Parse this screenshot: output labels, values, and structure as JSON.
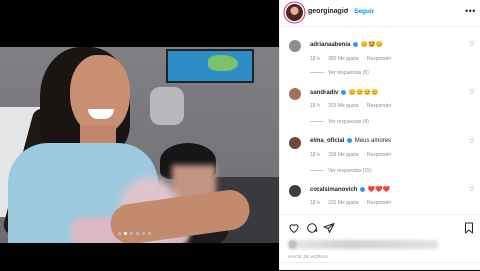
{
  "post": {
    "username": "georginagio",
    "separator": "•",
    "follow_label": "Seguir",
    "more_label": "•••",
    "time_label": "HACE 18 HORAS",
    "carousel_count": 6,
    "carousel_active": 2
  },
  "comments": [
    {
      "user": "adrianaabenia",
      "text": "😊🤩😊",
      "time": "18 h",
      "likes": "390 Me gusta",
      "reply": "Responder",
      "replies": "Ver respuestas (5)",
      "verified": true,
      "avatar_color": "#8a8f96"
    },
    {
      "user": "sandradiv",
      "text": "😊😊😊😊",
      "time": "18 h",
      "likes": "202 Me gusta",
      "reply": "Responder",
      "replies": "Ver respuestas (4)",
      "verified": true,
      "avatar_color": "#a0725a"
    },
    {
      "user": "elma_oficial",
      "text": "Meus amores",
      "time": "18 h",
      "likes": "339 Me gusta",
      "reply": "Responder",
      "replies": "Ver respuestas (15)",
      "verified": true,
      "avatar_color": "#6b4a3a"
    },
    {
      "user": "coralsimanovich",
      "text": "❤️❤️❤️",
      "time": "18 h",
      "likes": "231 Me gusta",
      "reply": "Responder",
      "replies": "",
      "verified": true,
      "avatar_color": "#3e3e3e"
    }
  ],
  "icons": {
    "like": "heart-icon",
    "comment": "comment-icon",
    "share": "share-icon",
    "save": "bookmark-icon",
    "comment_like": "heart-outline-icon"
  },
  "colors": {
    "follow_blue": "#0095f6",
    "verified_blue": "#3897f0",
    "meta_gray": "#8e8e8e",
    "text_dark": "#262626"
  }
}
